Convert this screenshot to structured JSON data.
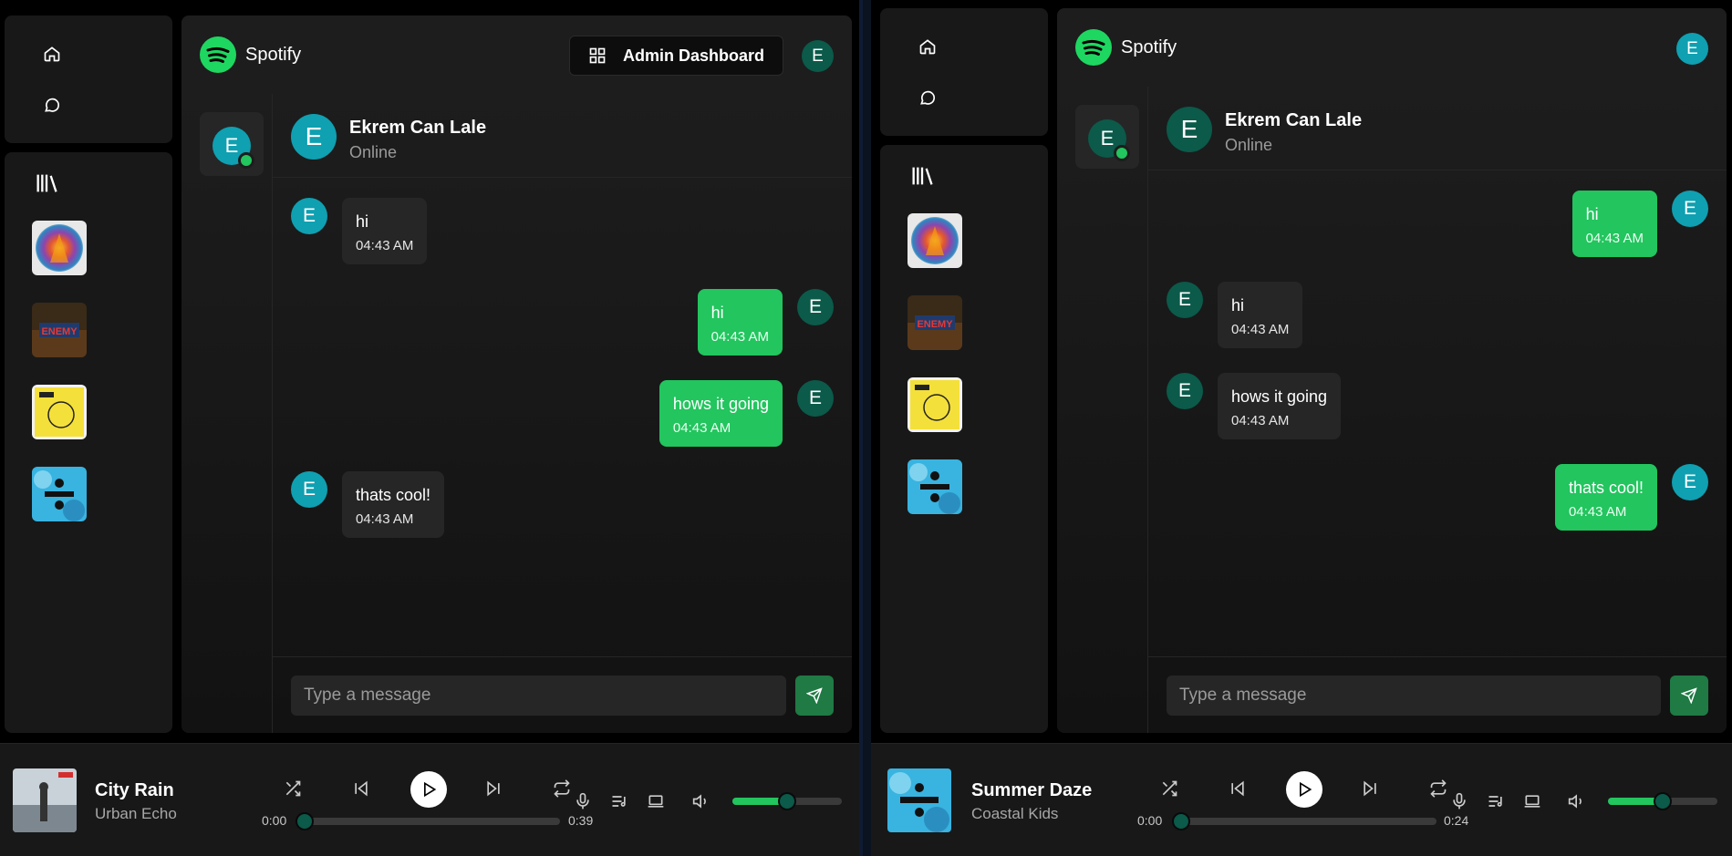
{
  "left": {
    "brand": "Spotify",
    "admin_button": "Admin Dashboard",
    "user_initial": "E",
    "contact": {
      "initial": "E",
      "name": "Ekrem Can Lale",
      "status": "Online"
    },
    "messages": [
      {
        "from": "them",
        "text": "hi",
        "time": "04:43 AM"
      },
      {
        "from": "me",
        "text": "hi",
        "time": "04:43 AM"
      },
      {
        "from": "me",
        "text": "hows it going",
        "time": "04:43 AM"
      },
      {
        "from": "them",
        "text": "thats cool!",
        "time": "04:43 AM"
      }
    ],
    "input_placeholder": "Type a message",
    "player": {
      "title": "City Rain",
      "artist": "Urban Echo",
      "current": "0:00",
      "total": "0:39",
      "progress": 0,
      "volume": 0.5
    }
  },
  "right": {
    "brand": "Spotify",
    "user_initial": "E",
    "contact": {
      "initial": "E",
      "name": "Ekrem Can Lale",
      "status": "Online"
    },
    "messages": [
      {
        "from": "me",
        "text": "hi",
        "time": "04:43 AM"
      },
      {
        "from": "them",
        "text": "hi",
        "time": "04:43 AM"
      },
      {
        "from": "them",
        "text": "hows it going",
        "time": "04:43 AM"
      },
      {
        "from": "me",
        "text": "thats cool!",
        "time": "04:43 AM"
      }
    ],
    "input_placeholder": "Type a message",
    "player": {
      "title": "Summer Daze",
      "artist": "Coastal Kids",
      "current": "0:00",
      "total": "0:24",
      "progress": 0,
      "volume": 0.5
    }
  },
  "colors": {
    "accent": "#22c55e",
    "teal_avatar": "#0fa0b1",
    "dark_avatar": "#0b5a4a",
    "panel": "#181818",
    "background": "#000000"
  },
  "icons": [
    "home-icon",
    "chat-icon",
    "library-icon",
    "dashboard-icon",
    "send-icon",
    "shuffle-icon",
    "previous-icon",
    "play-icon",
    "next-icon",
    "repeat-icon",
    "microphone-icon",
    "queue-icon",
    "device-icon",
    "volume-icon"
  ]
}
